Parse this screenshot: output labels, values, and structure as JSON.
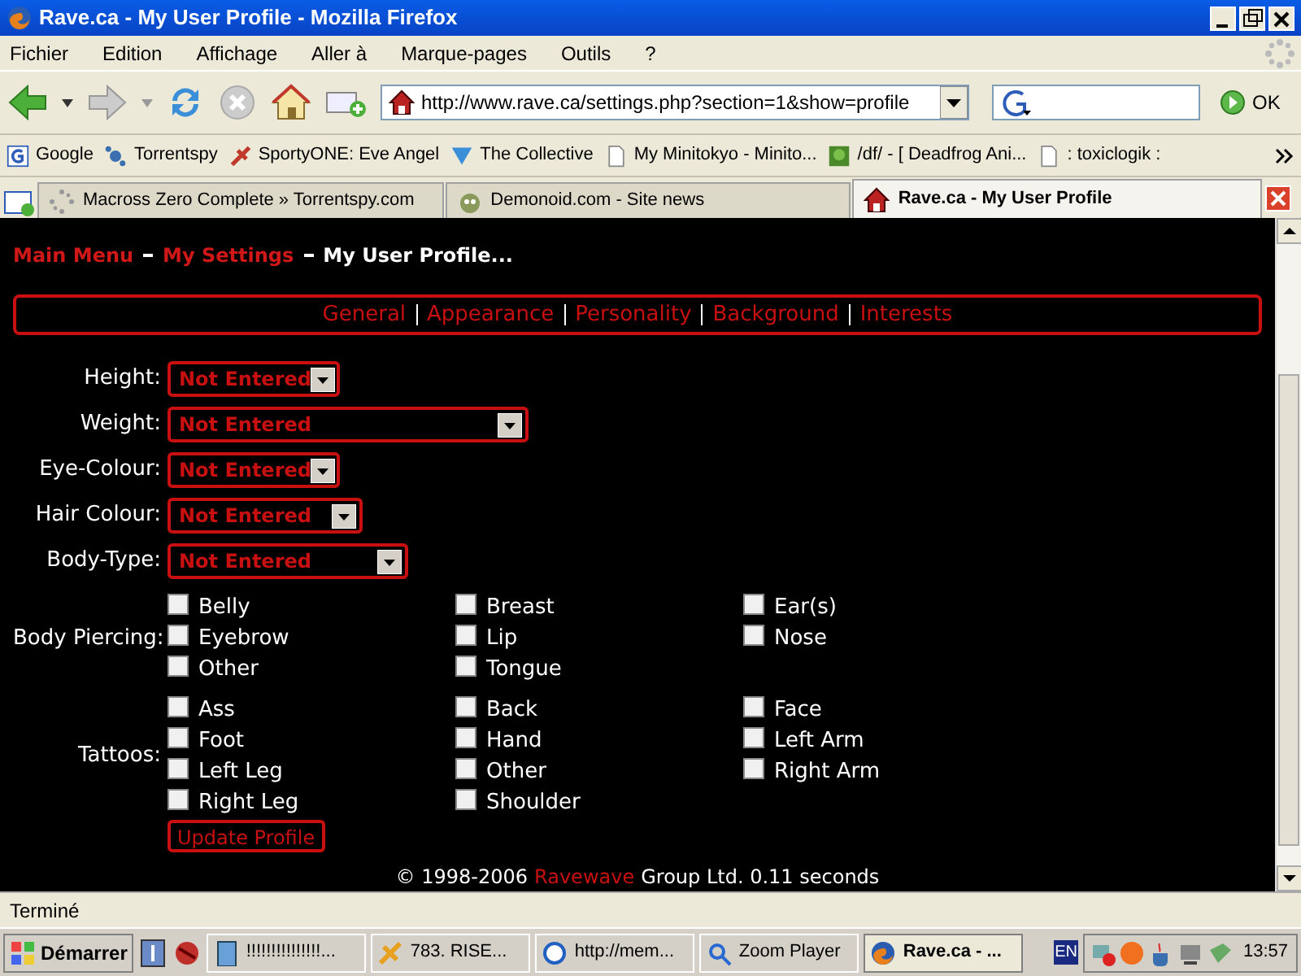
{
  "window": {
    "title": "Rave.ca - My User Profile - Mozilla Firefox"
  },
  "menu": [
    "Fichier",
    "Edition",
    "Affichage",
    "Aller à",
    "Marque-pages",
    "Outils",
    "?"
  ],
  "address": {
    "value": "http://www.rave.ca/settings.php?section=1&show=profile"
  },
  "search_button": "OK",
  "bookmarks": [
    "Google",
    "Torrentspy",
    "SportyONE: Eve Angel",
    "The Collective",
    "My Minitokyo - Minito...",
    "/df/ - [ Deadfrog Ani...",
    ": toxiclogik :"
  ],
  "tabs": [
    {
      "label": "Macross Zero Complete » Torrentspy.com",
      "selected": false
    },
    {
      "label": "Demonoid.com - Site news",
      "selected": false
    },
    {
      "label": "Rave.ca - My User Profile",
      "selected": true
    }
  ],
  "breadcrumb": [
    {
      "label": "Main Menu",
      "kind": "link"
    },
    {
      "label": "My Settings",
      "kind": "link"
    },
    {
      "label": "My User Profile...",
      "kind": "current"
    }
  ],
  "section_links": [
    "General",
    "Appearance",
    "Personality",
    "Background",
    "Interests"
  ],
  "fields": [
    {
      "label": "Height:",
      "value": "Not Entered"
    },
    {
      "label": "Weight:",
      "value": "Not Entered"
    },
    {
      "label": "Eye-Colour:",
      "value": "Not Entered"
    },
    {
      "label": "Hair Colour:",
      "value": "Not Entered"
    },
    {
      "label": "Body-Type:",
      "value": "Not Entered"
    }
  ],
  "checkbox_groups": [
    {
      "label": "Body Piercing:",
      "options": [
        {
          "label": "Belly",
          "checked": false
        },
        {
          "label": "Breast",
          "checked": false
        },
        {
          "label": "Ear(s)",
          "checked": false
        },
        {
          "label": "Eyebrow",
          "checked": false
        },
        {
          "label": "Lip",
          "checked": false
        },
        {
          "label": "Nose",
          "checked": false
        },
        {
          "label": "Other",
          "checked": false
        },
        {
          "label": "Tongue",
          "checked": false
        }
      ]
    },
    {
      "label": "Tattoos:",
      "options": [
        {
          "label": "Ass",
          "checked": false
        },
        {
          "label": "Back",
          "checked": false
        },
        {
          "label": "Face",
          "checked": false
        },
        {
          "label": "Foot",
          "checked": false
        },
        {
          "label": "Hand",
          "checked": false
        },
        {
          "label": "Left Arm",
          "checked": false
        },
        {
          "label": "Left Leg",
          "checked": false
        },
        {
          "label": "Other",
          "checked": false
        },
        {
          "label": "Right Arm",
          "checked": false
        },
        {
          "label": "Right Leg",
          "checked": false
        },
        {
          "label": "Shoulder",
          "checked": false
        }
      ]
    }
  ],
  "submit": "Update Profile",
  "footer": {
    "copyright": "© 1998-2006",
    "company_link": "Ravewave",
    "rest": "Group Ltd. 0.11 seconds"
  },
  "status_bar": "Terminé",
  "taskbar": {
    "start": "Démarrer",
    "tasks": [
      {
        "label": "!!!!!!!!!!!!!!!...",
        "selected": false
      },
      {
        "label": "783. RISE...",
        "selected": false
      },
      {
        "label": "http://mem...",
        "selected": false
      },
      {
        "label": "Zoom Player",
        "selected": false
      },
      {
        "label": "Rave.ca - ...",
        "selected": true
      }
    ],
    "language": "EN",
    "clock": "13:57"
  }
}
